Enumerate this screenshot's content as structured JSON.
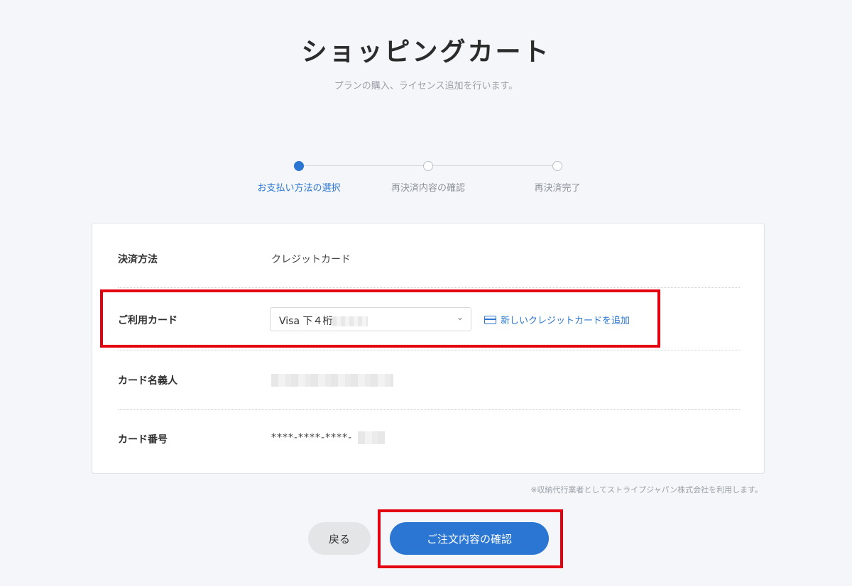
{
  "header": {
    "title": "ショッピングカート",
    "subtitle": "プランの購入、ライセンス追加を行います。"
  },
  "stepper": {
    "steps": [
      {
        "label": "お支払い方法の選択",
        "active": true
      },
      {
        "label": "再決済内容の確認",
        "active": false
      },
      {
        "label": "再決済完了",
        "active": false
      }
    ]
  },
  "form": {
    "payment_method": {
      "label": "決済方法",
      "value": "クレジットカード"
    },
    "card_select": {
      "label": "ご利用カード",
      "value": "Visa 下４桁"
    },
    "add_card_link": "新しいクレジットカードを追加",
    "card_holder": {
      "label": "カード名義人"
    },
    "card_number": {
      "label": "カード番号",
      "value": "****-****-****-"
    }
  },
  "note": "※収納代行業者としてストライプジャパン株式会社を利用します。",
  "buttons": {
    "back": "戻る",
    "confirm": "ご注文内容の確認"
  },
  "colors": {
    "accent": "#2a76d2",
    "highlight": "#e3000f",
    "background": "#f5f6f9"
  }
}
